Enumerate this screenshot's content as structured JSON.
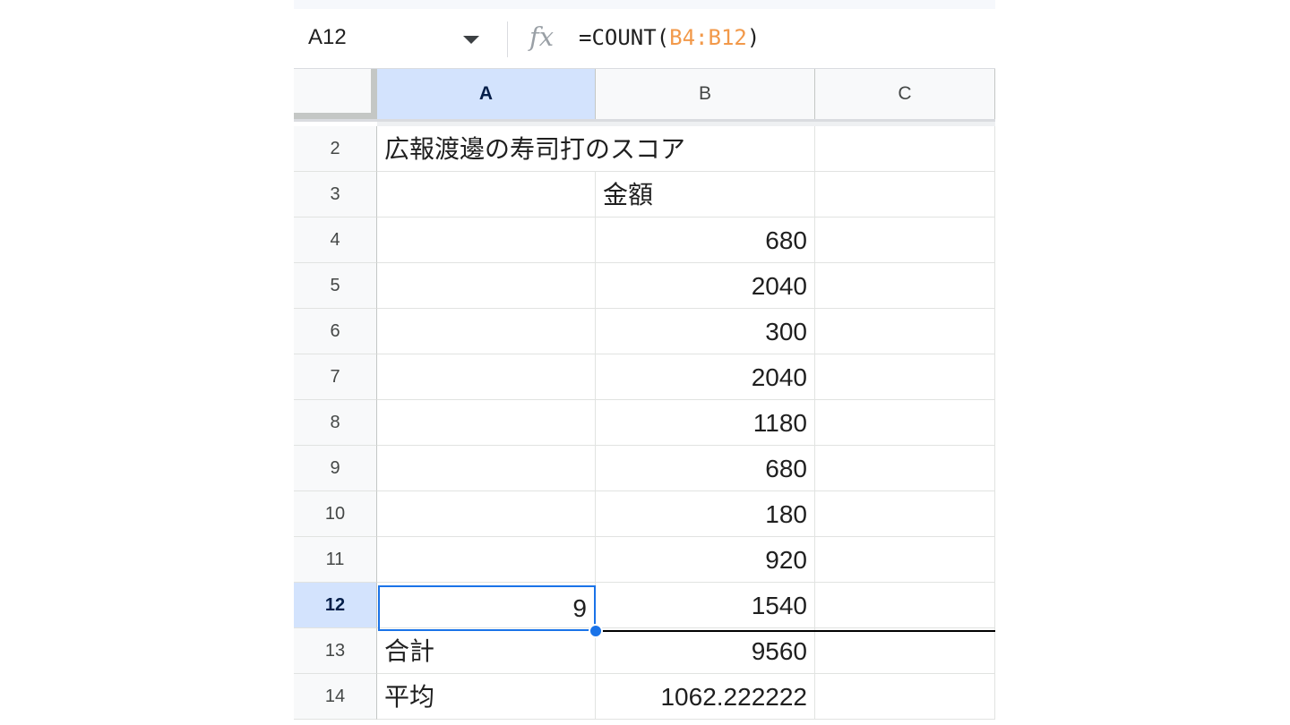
{
  "formula_bar": {
    "name_box": "A12",
    "fx": "fx",
    "formula_prefix": "=COUNT(",
    "formula_ref": "B4:B12",
    "formula_suffix": ")"
  },
  "columns": [
    "A",
    "B",
    "C"
  ],
  "rows": [
    {
      "num": "2",
      "a": "広報渡邊の寿司打のスコア",
      "b": "",
      "c": ""
    },
    {
      "num": "3",
      "a": "",
      "b": "金額",
      "c": ""
    },
    {
      "num": "4",
      "a": "",
      "b": "680",
      "c": ""
    },
    {
      "num": "5",
      "a": "",
      "b": "2040",
      "c": ""
    },
    {
      "num": "6",
      "a": "",
      "b": "300",
      "c": ""
    },
    {
      "num": "7",
      "a": "",
      "b": "2040",
      "c": ""
    },
    {
      "num": "8",
      "a": "",
      "b": "1180",
      "c": ""
    },
    {
      "num": "9",
      "a": "",
      "b": "680",
      "c": ""
    },
    {
      "num": "10",
      "a": "",
      "b": "180",
      "c": ""
    },
    {
      "num": "11",
      "a": "",
      "b": "920",
      "c": ""
    },
    {
      "num": "12",
      "a": "9",
      "b": "1540",
      "c": ""
    },
    {
      "num": "13",
      "a": "合計",
      "b": "9560",
      "c": ""
    },
    {
      "num": "14",
      "a": "平均",
      "b": "1062.222222",
      "c": ""
    }
  ],
  "selection": {
    "cell": "A12",
    "column": "A",
    "row": "12",
    "value": "9"
  },
  "colors": {
    "selection": "#1a73e8",
    "header_selected": "#d3e3fd",
    "formula_ref": "#f2994a"
  }
}
